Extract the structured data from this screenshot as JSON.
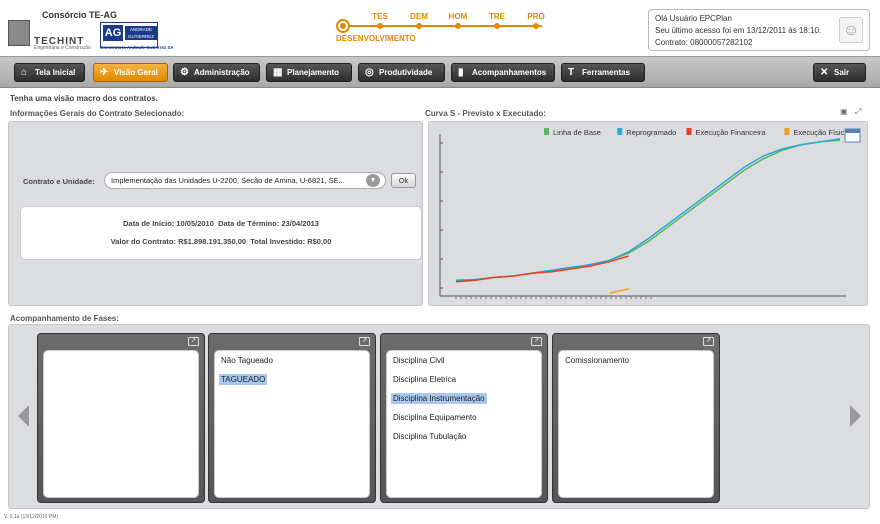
{
  "header": {
    "consortium": "Consórcio TE-AG",
    "techint_name": "TECHINT",
    "techint_sub": "Engenharia e Construção",
    "ag_letters": "AG",
    "ag_name": "ANDRADE GUTIERREZ",
    "ag_sub": "Construtora Andrade Gutierrez SA"
  },
  "phases": {
    "current": "DESENVOLVIMENTO",
    "steps": [
      "TES",
      "DEM",
      "HOM",
      "TRE",
      "PRO"
    ]
  },
  "user": {
    "greeting": "Olá Usuário EPCPlan",
    "last_access": "Seu último acesso foi em  13/12/2011 às 18:10.",
    "contract": "Contrato: 08000057282102"
  },
  "nav": {
    "items": [
      {
        "label": "Tela Inicial",
        "icon": "home-icon",
        "glyph": "⌂"
      },
      {
        "label": "Visão Geral",
        "icon": "telescope-icon",
        "glyph": "✈"
      },
      {
        "label": "Administração",
        "icon": "gear-icon",
        "glyph": "⚙"
      },
      {
        "label": "Planejamento",
        "icon": "map-icon",
        "glyph": "▦"
      },
      {
        "label": "Produtividade",
        "icon": "chart-circle-icon",
        "glyph": "◎"
      },
      {
        "label": "Acompanhamentos",
        "icon": "document-icon",
        "glyph": "▮"
      },
      {
        "label": "Ferramentas",
        "icon": "hammer-icon",
        "glyph": "T"
      }
    ],
    "exit_label": "Sair",
    "exit_glyph": "✕",
    "active_color": "#e08a00"
  },
  "main": {
    "intro": "Tenha uma visão macro dos contratos.",
    "info_title": "Informações Gerais do Contrato Selecionado:",
    "contract_label": "Contrato e Unidade:",
    "contract_value": "Implementação das Unidades U-2200, Secão de Amina, U-6821, SE...",
    "ok_label": "Ok",
    "start_date": "Data de Início: 10/05/2010",
    "end_date": "Data de Término: 23/04/2013",
    "contract_amount": "Valor do Contrato: R$1.898.191.350,00",
    "total_invested": "Total Investido: R$0,00"
  },
  "chart": {
    "title": "Curva S - Previsto x Executado:"
  },
  "chart_data": {
    "type": "line",
    "series": [
      {
        "name": "Linha de Base",
        "color": "#5cb85c",
        "values": [
          1,
          1.5,
          3,
          4,
          6,
          8,
          10,
          12,
          15,
          20,
          28,
          38,
          48,
          58,
          68,
          78,
          86,
          92,
          96,
          98,
          99
        ]
      },
      {
        "name": "Reprogramado",
        "color": "#2aa7e0",
        "values": [
          1,
          1.5,
          3,
          4,
          6,
          8,
          10,
          12,
          15,
          21,
          30,
          40,
          50,
          60,
          70,
          80,
          88,
          93,
          96,
          98,
          100
        ]
      },
      {
        "name": "Execução Financeira",
        "color": "#e0421b",
        "values": [
          0,
          1,
          3,
          4,
          6,
          7,
          9,
          11,
          14,
          18
        ]
      },
      {
        "name": "Execução Física",
        "color": "#f0a020",
        "values": [
          null,
          null,
          null,
          null,
          null,
          null,
          null,
          null,
          -8,
          -5
        ]
      }
    ],
    "ylim": [
      -10,
      102
    ],
    "grid": false,
    "legend": "top-right"
  },
  "fases": {
    "title": "Acompanhamento de Fases:",
    "cards": [
      {
        "items": []
      },
      {
        "items": [
          "Não Tagueado",
          "TAGUEADO"
        ],
        "selected": 1
      },
      {
        "items": [
          "Disciplina Civil",
          "Disciplina Eletrica",
          "Disciplina Instrumentação",
          "Disciplina Equipamento",
          "Disciplina Tubulação"
        ],
        "selected": 2
      },
      {
        "items": [
          "Comissionamento"
        ],
        "selected": -1
      }
    ]
  },
  "footer": {
    "version": "V. 0.1a (13/12/2010 PM)"
  }
}
